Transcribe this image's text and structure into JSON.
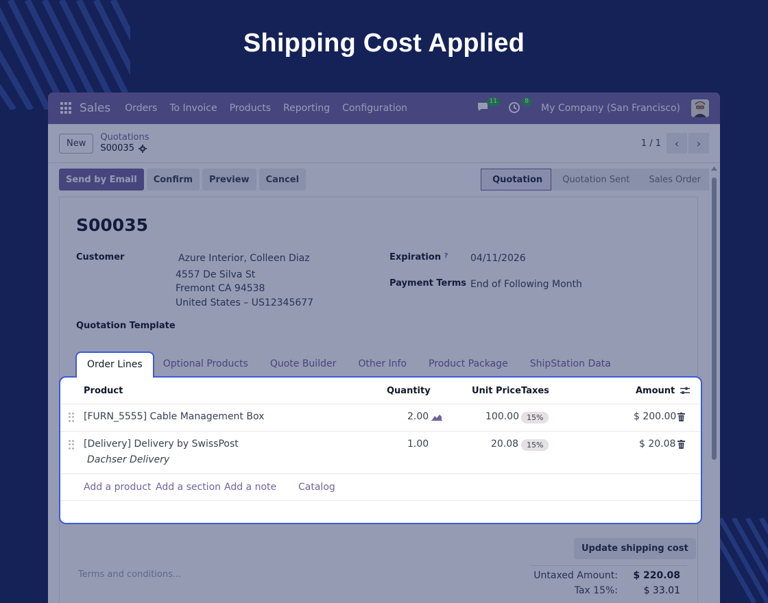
{
  "headline": "Shipping Cost Applied",
  "navbar": {
    "app_name": "Sales",
    "menu": [
      "Orders",
      "To Invoice",
      "Products",
      "Reporting",
      "Configuration"
    ],
    "messages_count": "11",
    "activities_count": "8",
    "company": "My Company (San Francisco)"
  },
  "control_panel": {
    "new_label": "New",
    "breadcrumb_parent": "Quotations",
    "record": "S00035",
    "pager": "1 / 1"
  },
  "actions": {
    "send_email": "Send by Email",
    "confirm": "Confirm",
    "preview": "Preview",
    "cancel": "Cancel"
  },
  "stages": [
    "Quotation",
    "Quotation Sent",
    "Sales Order"
  ],
  "form": {
    "name": "S00035",
    "customer_label": "Customer",
    "customer_name": "Azure Interior, Colleen Diaz",
    "address_1": "4557 De Silva St",
    "address_2": "Fremont CA 94538",
    "address_3": "United States – US12345677",
    "expiration_label": "Expiration",
    "expiration_help": "?",
    "expiration_value": "04/11/2026",
    "payment_terms_label": "Payment Terms",
    "payment_terms_value": "End of Following Month",
    "template_label": "Quotation Template"
  },
  "tabs": [
    "Order Lines",
    "Optional Products",
    "Quote Builder",
    "Other Info",
    "Product Package",
    "ShipStation Data"
  ],
  "order_lines": {
    "headers": {
      "product": "Product",
      "quantity": "Quantity",
      "unit_price": "Unit Price",
      "taxes": "Taxes",
      "amount": "Amount"
    },
    "rows": [
      {
        "product": "[FURN_5555] Cable Management Box",
        "quantity": "2.00",
        "unit_price": "100.00",
        "tax": "15%",
        "amount": "$ 200.00",
        "note": ""
      },
      {
        "product": "[Delivery] Delivery by SwissPost",
        "quantity": "1.00",
        "unit_price": "20.08",
        "tax": "15%",
        "amount": "$ 20.08",
        "note": "Dachser Delivery"
      }
    ],
    "add_product": "Add a product",
    "add_section": "Add a section",
    "add_note": "Add a note",
    "catalog": "Catalog"
  },
  "footer": {
    "update_shipping": "Update shipping cost",
    "terms_placeholder": "Terms and conditions...",
    "untaxed_label": "Untaxed Amount:",
    "untaxed_value": "$ 220.08",
    "tax_label": "Tax 15%:",
    "tax_value": "$ 33.01"
  },
  "colors": {
    "brand": "#71639e",
    "background": "#142257",
    "highlight": "#3b5bdb"
  }
}
